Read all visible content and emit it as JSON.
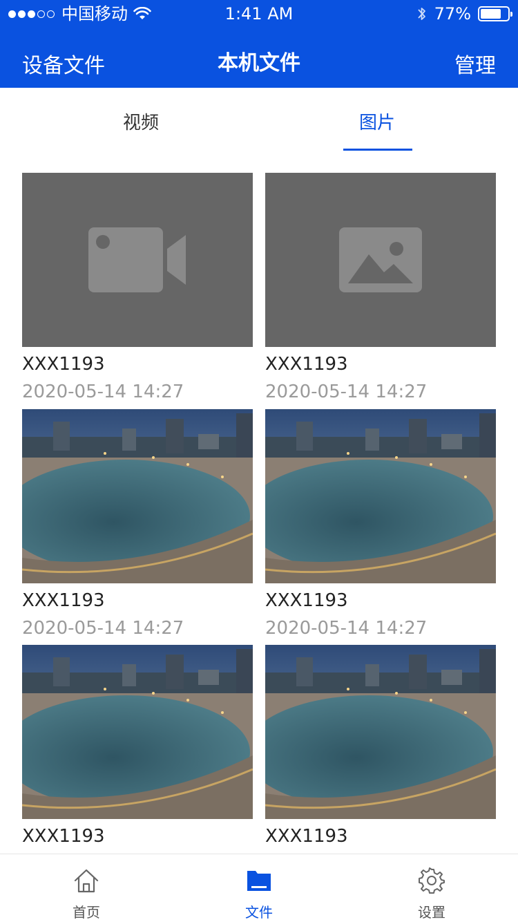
{
  "status_bar": {
    "carrier": "中国移动",
    "time": "1:41 AM",
    "battery": "77%",
    "battery_level": 0.77,
    "signal_dots_filled": 3,
    "signal_dots_total": 5
  },
  "nav": {
    "left": "设备文件",
    "title": "本机文件",
    "right": "管理"
  },
  "tabs": [
    {
      "label": "视频",
      "active": false
    },
    {
      "label": "图片",
      "active": true
    }
  ],
  "files": [
    {
      "name": "XXX1193",
      "time": "2020-05-14 14:27",
      "thumb": "video-placeholder-icon"
    },
    {
      "name": "XXX1193",
      "time": "2020-05-14 14:27",
      "thumb": "image-placeholder-icon"
    },
    {
      "name": "XXX1193",
      "time": "2020-05-14 14:27",
      "thumb": "city-lake-photo"
    },
    {
      "name": "XXX1193",
      "time": "2020-05-14 14:27",
      "thumb": "city-lake-photo"
    },
    {
      "name": "XXX1193",
      "time": "",
      "thumb": "city-lake-photo"
    },
    {
      "name": "XXX1193",
      "time": "",
      "thumb": "city-lake-photo"
    }
  ],
  "tabbar": [
    {
      "label": "首页",
      "icon": "home-icon",
      "active": false
    },
    {
      "label": "文件",
      "icon": "folder-icon",
      "active": true
    },
    {
      "label": "设置",
      "icon": "gear-icon",
      "active": false
    }
  ],
  "colors": {
    "brand": "#0a52e0",
    "placeholder_bg": "#666666",
    "placeholder_icon": "#8a8a8a"
  }
}
